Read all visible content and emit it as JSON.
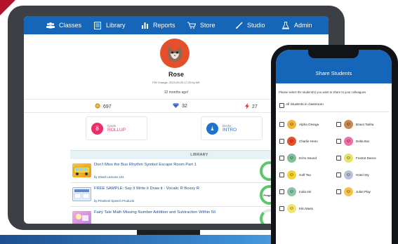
{
  "nav": {
    "items": [
      {
        "label": "Classes",
        "icon": "group-icon"
      },
      {
        "label": "Library",
        "icon": "book-icon"
      },
      {
        "label": "Reports",
        "icon": "bar-chart-icon"
      },
      {
        "label": "Store",
        "icon": "cart-icon"
      },
      {
        "label": "Studio",
        "icon": "brush-icon"
      },
      {
        "label": "Admin",
        "icon": "flask-icon"
      }
    ]
  },
  "profile": {
    "name": "Rose",
    "pw_change": "PW Change: 2023-09-29 17:29 by ME",
    "ago": "12 months ago!"
  },
  "stats": {
    "coins": "697",
    "gems": "32",
    "bolts": "27"
  },
  "cards": {
    "cards_count": "32",
    "cards_label": "Cards",
    "cards_value": "ROLLUP",
    "decks_count": "1",
    "decks_label": "Decks",
    "decks_value": "INTRO"
  },
  "library": {
    "heading": "LIBRARY",
    "items": [
      {
        "title": "Don't Miss the Bus Rhythm Symbol Escape Room Part 1",
        "by": "by Smart Lessons 101"
      },
      {
        "title": "FREE SAMPLE: Say it Write it Draw it - Vocalic R Bossy R",
        "by": "by Pinwheel Speech Products",
        "ring_label": "Progress"
      },
      {
        "title": "Fairy Tale Math Missing Number Addition and Subtraction Within 50",
        "by": ""
      }
    ]
  },
  "share": {
    "title": "Share Students",
    "instruction": "Please select the student(s) you want to share to your colleagues",
    "all_label": "All Students in classroom",
    "students": [
      "Alpha Omega",
      "Bravo Tasha",
      "Charlie Henn",
      "Delta Bar",
      "Echo Sound",
      "Foxtrot Dance",
      "Golf Tsa",
      "Hotel Sty",
      "India Ink",
      "Juliet Play",
      "Kilo Mass"
    ]
  },
  "colors": {
    "brand_blue": "#1565b8",
    "accent_red": "#e4502c",
    "progress_green": "#5cc66a"
  }
}
